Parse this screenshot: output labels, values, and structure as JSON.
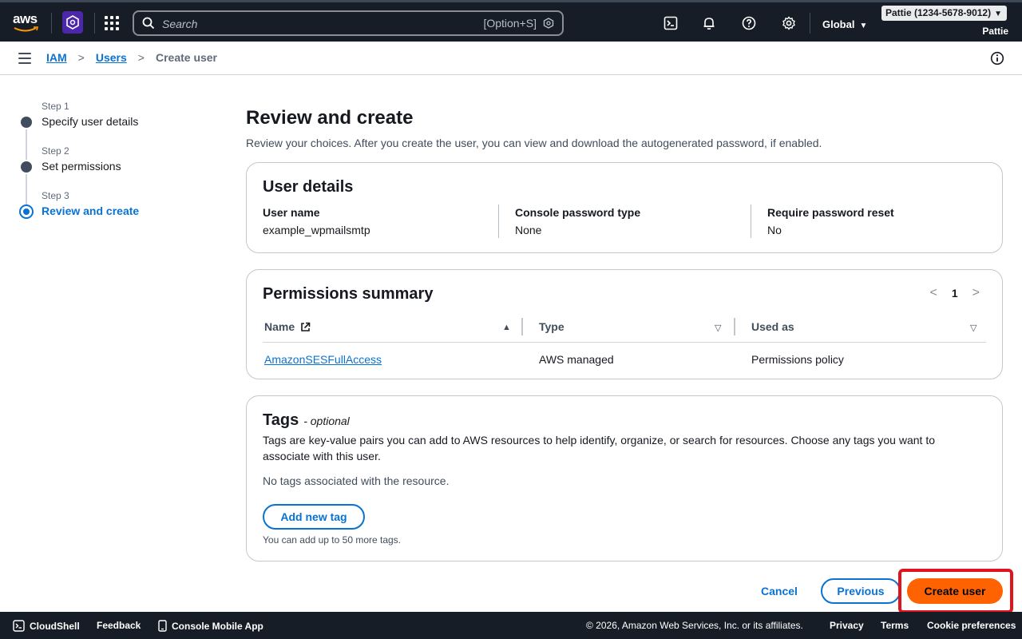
{
  "topnav": {
    "logo_text": "aws",
    "search_placeholder": "Search",
    "search_shortcut": "[Option+S]",
    "region": "Global",
    "account": "Pattie (1234-5678-9012)",
    "user": "Pattie"
  },
  "breadcrumb": {
    "items": [
      "IAM",
      "Users"
    ],
    "current": "Create user"
  },
  "steps": [
    {
      "number": "Step 1",
      "title": "Specify user details"
    },
    {
      "number": "Step 2",
      "title": "Set permissions"
    },
    {
      "number": "Step 3",
      "title": "Review and create"
    }
  ],
  "page": {
    "title": "Review and create",
    "description": "Review your choices. After you create the user, you can view and download the autogenerated password, if enabled."
  },
  "user_details": {
    "title": "User details",
    "fields": [
      {
        "label": "User name",
        "value": "example_wpmailsmtp"
      },
      {
        "label": "Console password type",
        "value": "None"
      },
      {
        "label": "Require password reset",
        "value": "No"
      }
    ]
  },
  "permissions": {
    "title": "Permissions summary",
    "page": "1",
    "columns": [
      "Name",
      "Type",
      "Used as"
    ],
    "rows": [
      {
        "name": "AmazonSESFullAccess",
        "type": "AWS managed",
        "used_as": "Permissions policy"
      }
    ]
  },
  "tags": {
    "title": "Tags",
    "optional": "- optional",
    "description": "Tags are key-value pairs you can add to AWS resources to help identify, organize, or search for resources. Choose any tags you want to associate with this user.",
    "empty": "No tags associated with the resource.",
    "add_button": "Add new tag",
    "hint": "You can add up to 50 more tags."
  },
  "actions": {
    "cancel": "Cancel",
    "previous": "Previous",
    "create": "Create user"
  },
  "bottombar": {
    "cloudshell": "CloudShell",
    "feedback": "Feedback",
    "mobile": "Console Mobile App",
    "copyright": "© 2026, Amazon Web Services, Inc. or its affiliates.",
    "privacy": "Privacy",
    "terms": "Terms",
    "cookies": "Cookie preferences"
  },
  "colors": {
    "nav_bg": "#161d26",
    "link": "#0972d3",
    "primary_button": "#ff6200",
    "highlight": "#e0141e"
  }
}
